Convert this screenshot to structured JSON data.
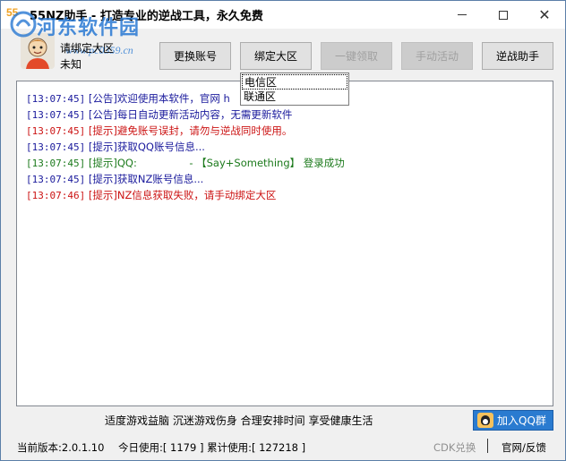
{
  "app": {
    "logo": "55",
    "title": "55NZ助手 - 打造专业的逆战工具，永久免费"
  },
  "window_controls": {
    "minimize_icon": "minimize-icon",
    "maximize_icon": "maximize-icon",
    "close_icon": "close-icon",
    "close_glyph": "✕"
  },
  "watermark": {
    "title": "河东软件园",
    "url": "www.pc0359.cn"
  },
  "user": {
    "status": "请绑定大区",
    "region": "未知"
  },
  "toolbar": {
    "change_account": "更换账号",
    "bind_region": "绑定大区",
    "one_click_claim": "一键领取",
    "manual_activity": "手动活动",
    "nz_assistant": "逆战助手"
  },
  "region_dropdown": {
    "options": [
      "电信区",
      "联通区"
    ]
  },
  "log": {
    "lines": [
      {
        "time": "[13:07:45]",
        "text": "[公告]欢迎使用本软件，官网 h",
        "color": "blue"
      },
      {
        "time": "[13:07:45]",
        "text": "[公告]每日自动更新活动内容，无需更新软件",
        "color": "blue"
      },
      {
        "time": "[13:07:45]",
        "text": "[提示]避免账号误封，请勿与逆战同时使用。",
        "color": "red"
      },
      {
        "time": "[13:07:45]",
        "text": "[提示]获取QQ账号信息...",
        "color": "blue"
      },
      {
        "time": "[13:07:45]",
        "text": "[提示]QQ:                - 【Say+Something】 登录成功",
        "color": "green"
      },
      {
        "time": "[13:07:45]",
        "text": "[提示]获取NZ账号信息...",
        "color": "blue"
      },
      {
        "time": "[13:07:46]",
        "text": "[提示]NZ信息获取失败，请手动绑定大区",
        "color": "red"
      }
    ]
  },
  "slogan": "适度游戏益脑 沉迷游戏伤身 合理安排时间 享受健康生活",
  "qq_group": {
    "label": "加入QQ群"
  },
  "status": {
    "version": "当前版本:2.0.1.10",
    "usage": "今日使用:[ 1179 ] 累计使用:[ 127218 ]",
    "cdk": "CDK兑换",
    "feedback": "官网/反馈"
  },
  "colors": {
    "blue": "#1a1a9c",
    "red": "#cc1414",
    "green": "#1c7a1c",
    "accent": "#2a7bd0"
  }
}
